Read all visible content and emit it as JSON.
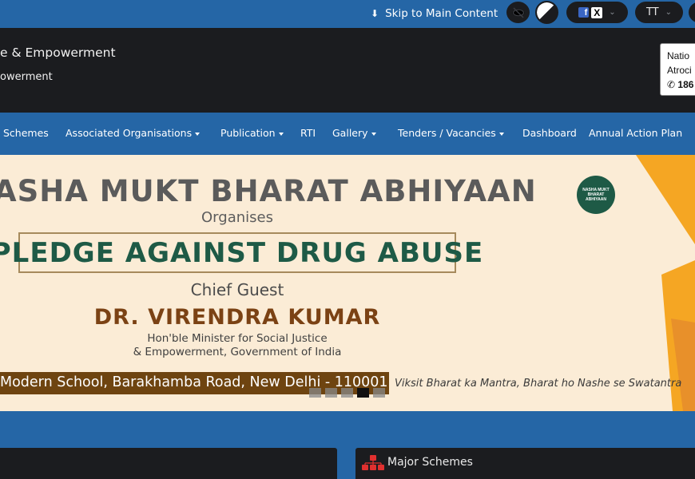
{
  "topbar": {
    "skip_label": "Skip to Main Content",
    "font_size_label": "TT",
    "social_fb": "f",
    "social_x": "X"
  },
  "header": {
    "title_line1": "e & Empowerment",
    "title_line2": "owerment",
    "helpline_line1": "Natio",
    "helpline_line2": "Atroci",
    "helpline_number": "186"
  },
  "nav": {
    "items": [
      {
        "label": "Schemes",
        "dropdown": false
      },
      {
        "label": "Associated Organisations",
        "dropdown": true
      },
      {
        "label": "Publication",
        "dropdown": true
      },
      {
        "label": "RTI",
        "dropdown": false
      },
      {
        "label": "Gallery",
        "dropdown": true
      },
      {
        "label": "Tenders / Vacancies",
        "dropdown": true
      },
      {
        "label": "Dashboard",
        "dropdown": false
      },
      {
        "label": "Annual Action Plan",
        "dropdown": false
      }
    ]
  },
  "banner": {
    "title": "ASHA MUKT BHARAT ABHIYAAN",
    "organises": "Organises",
    "pledge": "PLEDGE AGAINST DRUG ABUSE",
    "chief_guest": "Chief Guest",
    "name": "DR. VIRENDRA KUMAR",
    "designation_line1": "Hon'ble Minister for Social Justice",
    "designation_line2": "& Empowerment, Government of India",
    "venue": "Modern School, Barakhamba Road, New Delhi - 110001",
    "tagline": "Viksit Bharat ka Mantra, Bharat ho Nashe se Swatantra",
    "logo_text": [
      "NASHA MUKT",
      "BHARAT",
      "ABHIYAAN"
    ],
    "slides": 5,
    "active_slide": 4
  },
  "sections": {
    "major_schemes": "Major Schemes"
  },
  "colors": {
    "primary_blue": "#2566a6",
    "dark": "#1b1c1f",
    "banner_bg": "#fbecd6",
    "pledge_green": "#1e5a46",
    "name_brown": "#7b4214",
    "orange_accent": "#f5a623"
  }
}
